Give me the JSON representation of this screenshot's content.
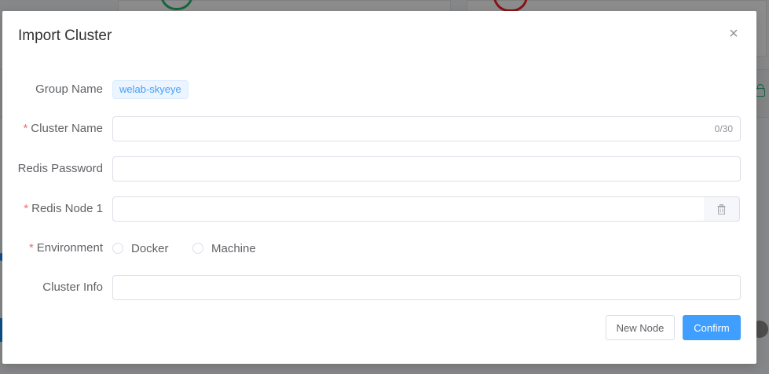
{
  "dialog": {
    "title": "Import Cluster",
    "close_label": "×"
  },
  "form": {
    "group_name": {
      "label": "Group Name",
      "value": "welab-skyeye"
    },
    "cluster_name": {
      "required_mark": "*",
      "label": "Cluster Name",
      "value": "",
      "counter": "0/30"
    },
    "redis_password": {
      "label": "Redis Password",
      "value": ""
    },
    "redis_node": {
      "required_mark": "*",
      "label": "Redis Node 1",
      "value": "",
      "append_icon": "trash-icon"
    },
    "environment": {
      "required_mark": "*",
      "label": "Environment",
      "options": [
        "Docker",
        "Machine"
      ],
      "selected": ""
    },
    "cluster_info": {
      "label": "Cluster Info",
      "value": ""
    }
  },
  "footer": {
    "new_node_label": "New Node",
    "confirm_label": "Confirm"
  },
  "colors": {
    "primary": "#409eff",
    "required": "#f56c6c",
    "tag_bg": "#ecf5ff",
    "overlay": "rgba(0,0,0,0.45)"
  }
}
